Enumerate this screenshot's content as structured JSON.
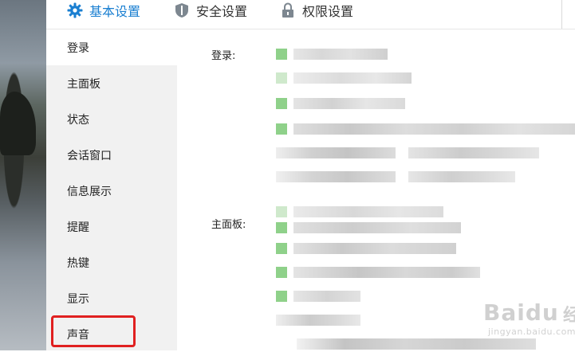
{
  "tabs": [
    {
      "label": "基本设置",
      "icon": "gear-icon",
      "active": true
    },
    {
      "label": "安全设置",
      "icon": "shield-icon",
      "active": false
    },
    {
      "label": "权限设置",
      "icon": "lock-icon",
      "active": false
    }
  ],
  "sidebar": {
    "items": [
      {
        "label": "登录"
      },
      {
        "label": "主面板"
      },
      {
        "label": "状态"
      },
      {
        "label": "会话窗口"
      },
      {
        "label": "信息展示"
      },
      {
        "label": "提醒"
      },
      {
        "label": "热键"
      },
      {
        "label": "显示"
      },
      {
        "label": "声音"
      }
    ]
  },
  "main": {
    "sections": [
      {
        "label": "登录:"
      },
      {
        "label": "主面板:"
      }
    ]
  },
  "watermark": {
    "brand": "Baidu",
    "suffix": "经验",
    "url": "jingyan.baidu.com"
  },
  "colors": {
    "accent": "#1a7fd1",
    "highlight": "#e02020",
    "sidebar_bg": "#f1f1f1"
  }
}
